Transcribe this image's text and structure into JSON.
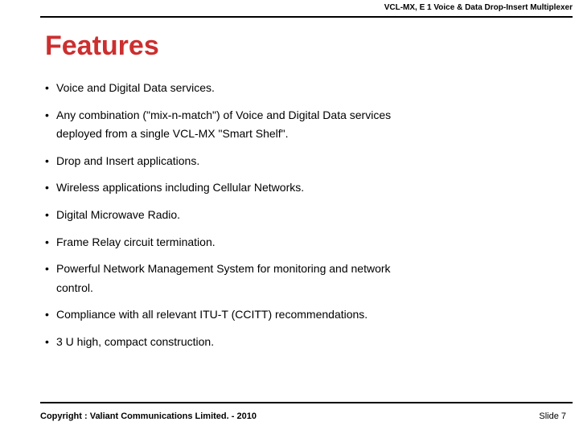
{
  "header": {
    "product": "VCL-MX, E 1 Voice & Data Drop-Insert Multiplexer"
  },
  "title": "Features",
  "bullets": {
    "b0": "Voice and Digital Data services.",
    "b1": "Any combination (\"mix-n-match\") of Voice and Digital Data services",
    "b1b": "deployed from a single VCL-MX \"Smart Shelf\".",
    "b2": "Drop and Insert applications.",
    "b3": "Wireless applications including Cellular Networks.",
    "b4": "Digital Microwave Radio.",
    "b5": "Frame Relay circuit termination.",
    "b6": "Powerful Network Management System for monitoring and network",
    "b6b": "control.",
    "b7": "Compliance with all relevant ITU-T (CCITT) recommendations.",
    "b8": "3 U high, compact construction."
  },
  "footer": {
    "copyright": "Copyright : Valiant Communications Limited. - 2010",
    "slide": "Slide 7"
  }
}
